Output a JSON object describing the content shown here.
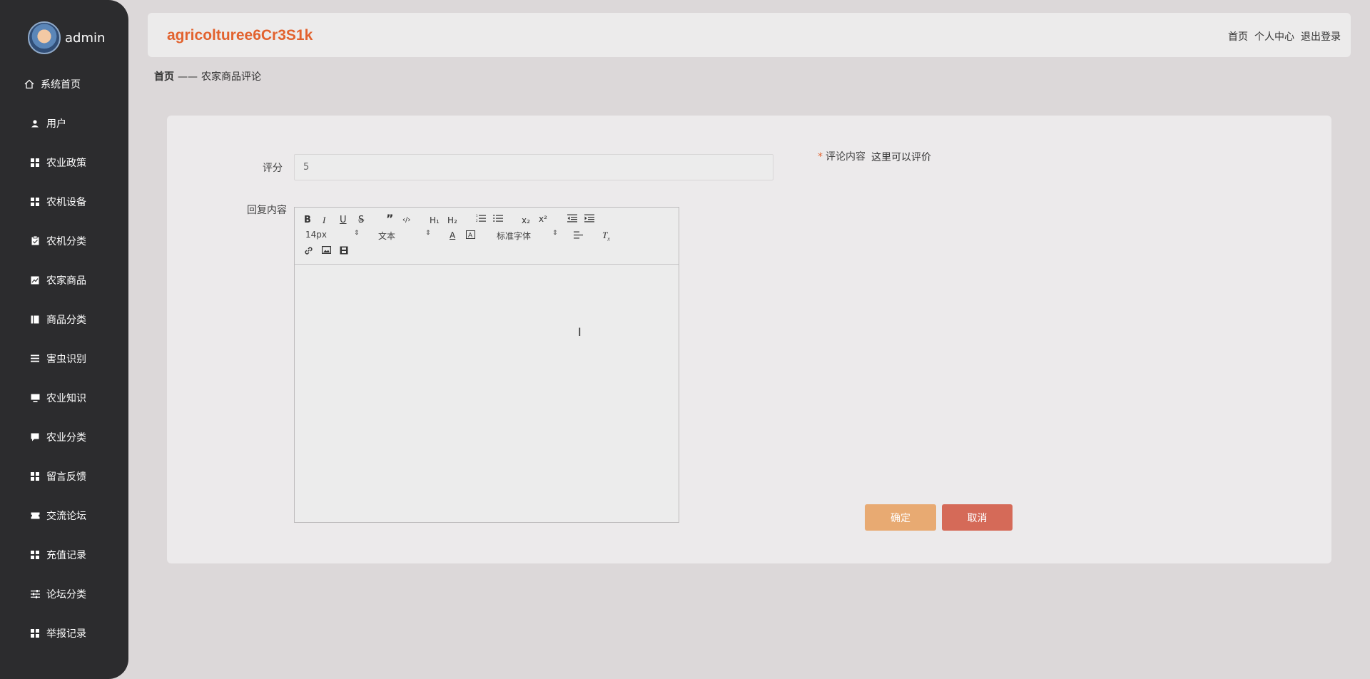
{
  "user": {
    "name": "admin"
  },
  "sidebar": {
    "items": [
      {
        "label": "系统首页",
        "icon": "home-icon"
      },
      {
        "label": "用户",
        "icon": "user-icon"
      },
      {
        "label": "农业政策",
        "icon": "grid-icon"
      },
      {
        "label": "农机设备",
        "icon": "grid-icon"
      },
      {
        "label": "农机分类",
        "icon": "clipboard-icon"
      },
      {
        "label": "农家商品",
        "icon": "chart-icon"
      },
      {
        "label": "商品分类",
        "icon": "book-icon"
      },
      {
        "label": "害虫识别",
        "icon": "menu-icon"
      },
      {
        "label": "农业知识",
        "icon": "monitor-icon"
      },
      {
        "label": "农业分类",
        "icon": "comment-icon"
      },
      {
        "label": "留言反馈",
        "icon": "grid-icon"
      },
      {
        "label": "交流论坛",
        "icon": "ticket-icon"
      },
      {
        "label": "充值记录",
        "icon": "grid-icon"
      },
      {
        "label": "论坛分类",
        "icon": "sliders-icon"
      },
      {
        "label": "举报记录",
        "icon": "grid-icon"
      }
    ]
  },
  "header": {
    "title": "agricolturee6Cr3S1k",
    "links": {
      "home": "首页",
      "profile": "个人中心",
      "logout": "退出登录"
    }
  },
  "breadcrumb": {
    "home": "首页",
    "separator": "——",
    "current": "农家商品评论"
  },
  "form": {
    "score_label": "评分",
    "score_value": "5",
    "reply_label": "回复内容",
    "comment_label": "评论内容",
    "comment_required_mark": "*",
    "comment_value": "这里可以评价"
  },
  "editor": {
    "font_size": "14px",
    "text_style": "文本",
    "font_family": "标准字体"
  },
  "buttons": {
    "confirm": "确定",
    "cancel": "取消"
  },
  "colors": {
    "accent": "#e2622e",
    "confirm": "#e8aa72",
    "cancel": "#d56a58",
    "sidebar": "#2c2c2e"
  }
}
